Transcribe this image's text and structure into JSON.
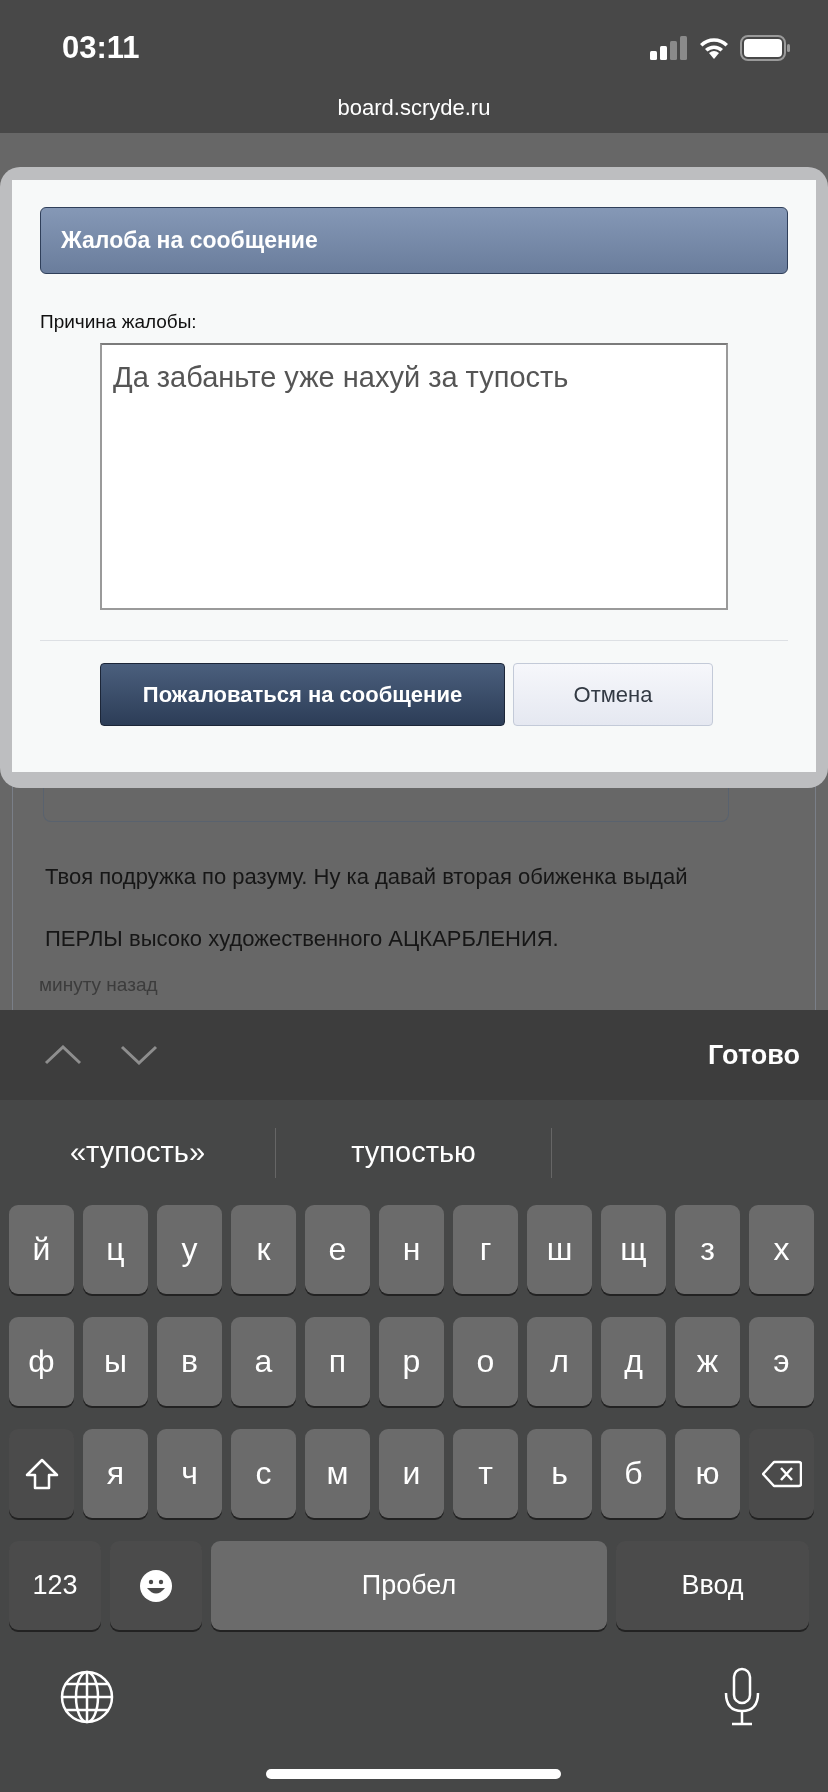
{
  "status_bar": {
    "time": "03:11",
    "url": "board.scryde.ru"
  },
  "background_post": {
    "text": "Твоя подружка по разуму. Ну ка давай вторая обиженка выдай ПЕРЛЫ высоко художественного АЦКАРБЛЕНИЯ.",
    "time": "минуту назад"
  },
  "dialog": {
    "title": "Жалоба на сообщение",
    "label": "Причина жалобы:",
    "reason": "Да забаньте уже нахуй за тупость",
    "buttons": [
      {
        "label": "Пожаловаться на сообщение",
        "kind": "primary"
      },
      {
        "label": "Отмена",
        "kind": "secondary"
      }
    ]
  },
  "accessory_bar": {
    "done": "Готово"
  },
  "suggestions": [
    "«тупость»",
    "тупостью"
  ],
  "keyboard": [
    [
      {
        "kind": "letter",
        "label": "й"
      },
      {
        "kind": "letter",
        "label": "ц"
      },
      {
        "kind": "letter",
        "label": "у"
      },
      {
        "kind": "letter",
        "label": "к"
      },
      {
        "kind": "letter",
        "label": "е"
      },
      {
        "kind": "letter",
        "label": "н"
      },
      {
        "kind": "letter",
        "label": "г"
      },
      {
        "kind": "letter",
        "label": "ш"
      },
      {
        "kind": "letter",
        "label": "щ"
      },
      {
        "kind": "letter",
        "label": "з"
      },
      {
        "kind": "letter",
        "label": "х"
      }
    ],
    [
      {
        "kind": "letter",
        "label": "ф"
      },
      {
        "kind": "letter",
        "label": "ы"
      },
      {
        "kind": "letter",
        "label": "в"
      },
      {
        "kind": "letter",
        "label": "а"
      },
      {
        "kind": "letter",
        "label": "п"
      },
      {
        "kind": "letter",
        "label": "р"
      },
      {
        "kind": "letter",
        "label": "о"
      },
      {
        "kind": "letter",
        "label": "л"
      },
      {
        "kind": "letter",
        "label": "д"
      },
      {
        "kind": "letter",
        "label": "ж"
      },
      {
        "kind": "letter",
        "label": "э"
      }
    ],
    [
      {
        "kind": "shift"
      },
      {
        "kind": "letter",
        "label": "я"
      },
      {
        "kind": "letter",
        "label": "ч"
      },
      {
        "kind": "letter",
        "label": "с"
      },
      {
        "kind": "letter",
        "label": "м"
      },
      {
        "kind": "letter",
        "label": "и"
      },
      {
        "kind": "letter",
        "label": "т"
      },
      {
        "kind": "letter",
        "label": "ь"
      },
      {
        "kind": "letter",
        "label": "б"
      },
      {
        "kind": "letter",
        "label": "ю"
      },
      {
        "kind": "backspace"
      }
    ],
    [
      {
        "kind": "numbers",
        "label": "123"
      },
      {
        "kind": "emoji"
      },
      {
        "kind": "space",
        "label": "Пробел"
      },
      {
        "kind": "return",
        "label": "Ввод"
      }
    ]
  ]
}
